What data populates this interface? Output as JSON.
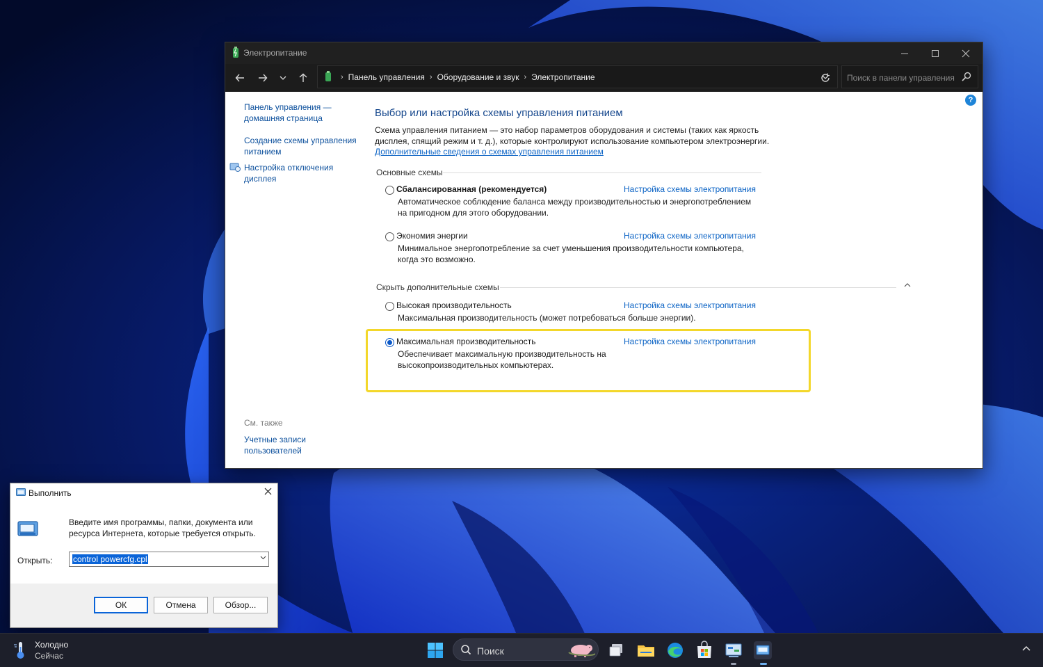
{
  "window": {
    "title": "Электропитание",
    "address": {
      "crumbs": [
        "Панель управления",
        "Оборудование и звук",
        "Электропитание"
      ]
    },
    "search_placeholder": "Поиск в панели управления",
    "help_label": "?"
  },
  "sidebar": {
    "items": [
      {
        "label": "Панель управления — домашняя страница"
      },
      {
        "label": "Создание схемы управления питанием"
      },
      {
        "label": "Настройка отключения дисплея"
      }
    ],
    "see_also_label": "См. также",
    "see_also_items": [
      {
        "label": "Учетные записи пользователей"
      }
    ]
  },
  "main": {
    "heading": "Выбор или настройка схемы управления питанием",
    "description": "Схема управления питанием — это набор параметров оборудования и системы (таких как яркость дисплея, спящий режим и т. д.), которые контролируют использование компьютером электроэнергии.",
    "more_info_link": "Дополнительные сведения о схемах управления питанием",
    "basic_group_label": "Основные схемы",
    "hidden_group_label": "Скрыть дополнительные схемы",
    "plans": [
      {
        "name": "Сбалансированная (рекомендуется)",
        "link": "Настройка схемы электропитания",
        "description": "Автоматическое соблюдение баланса между производительностью и энергопотреблением на пригодном для этого оборудовании.",
        "selected": false
      },
      {
        "name": "Экономия энергии",
        "link": "Настройка схемы электропитания",
        "description": "Минимальное энергопотребление за счет уменьшения производительности компьютера, когда это возможно.",
        "selected": false
      },
      {
        "name": "Высокая производительность",
        "link": "Настройка схемы электропитания",
        "description": "Максимальная производительность (может потребоваться больше энергии).",
        "selected": false
      },
      {
        "name": "Максимальная производительность",
        "link": "Настройка схемы электропитания",
        "description": "Обеспечивает максимальную производительность на высокопроизводительных компьютерах.",
        "selected": true
      }
    ],
    "highlight_color": "#f3d72a"
  },
  "run_dialog": {
    "title": "Выполнить",
    "prompt": "Введите имя программы, папки, документа или ресурса Интернета, которые требуется открыть.",
    "open_label": "Открыть:",
    "input_value": "control powercfg.cpl",
    "buttons": {
      "ok": "ОК",
      "cancel": "Отмена",
      "browse": "Обзор..."
    }
  },
  "taskbar": {
    "weather_line1": "Холодно",
    "weather_line2": "Сейчас",
    "search_label": "Поиск",
    "icons": [
      "start-icon",
      "search-icon",
      "task-view-icon",
      "file-explorer-icon",
      "edge-icon",
      "store-icon",
      "control-panel-icon",
      "run-icon",
      "tray-chevron-icon"
    ]
  },
  "colors": {
    "link": "#0b63c5",
    "heading": "#14468c",
    "accent": "#0a58c8"
  }
}
